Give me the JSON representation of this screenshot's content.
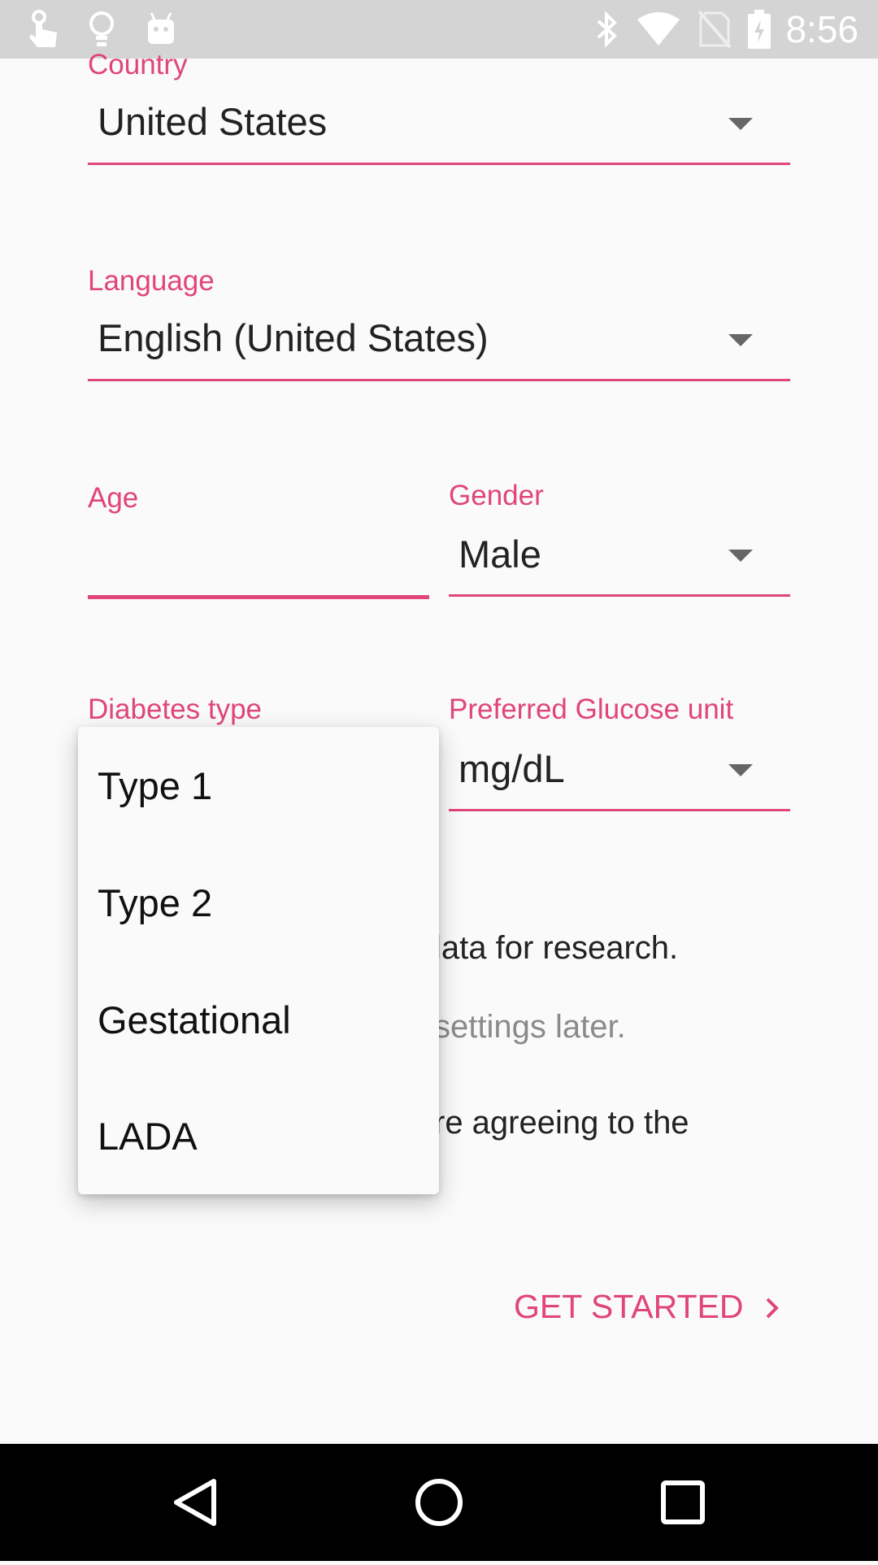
{
  "status_bar": {
    "time": "8:56",
    "left_icons": [
      "touch-icon",
      "lightbulb-icon",
      "android-icon"
    ],
    "right_icons": [
      "bluetooth-icon",
      "wifi-icon",
      "no-sim-icon",
      "battery-icon"
    ]
  },
  "form": {
    "country": {
      "label": "Country",
      "value": "United States"
    },
    "language": {
      "label": "Language",
      "value": "English (United States)"
    },
    "age": {
      "label": "Age",
      "value": ""
    },
    "gender": {
      "label": "Gender",
      "value": "Male"
    },
    "diabetes_type": {
      "label": "Diabetes type",
      "options": [
        "Type 1",
        "Type 2",
        "Gestational",
        "LADA"
      ]
    },
    "glucose_unit": {
      "label": "Preferred Glucose unit",
      "value": "mg/dL"
    }
  },
  "partial_text": {
    "research": "lata for research.",
    "settings": "settings later.",
    "agreeing": "re agreeing to the"
  },
  "cta": {
    "label": "GET STARTED",
    "icon": "chevron-right-icon"
  },
  "nav_bar": {
    "buttons": [
      "back-icon",
      "home-icon",
      "recents-icon"
    ]
  },
  "colors": {
    "accent": "#e0457b",
    "background": "#fafafa",
    "status_bar": "#d4d4d4",
    "nav_bar": "#000000"
  }
}
